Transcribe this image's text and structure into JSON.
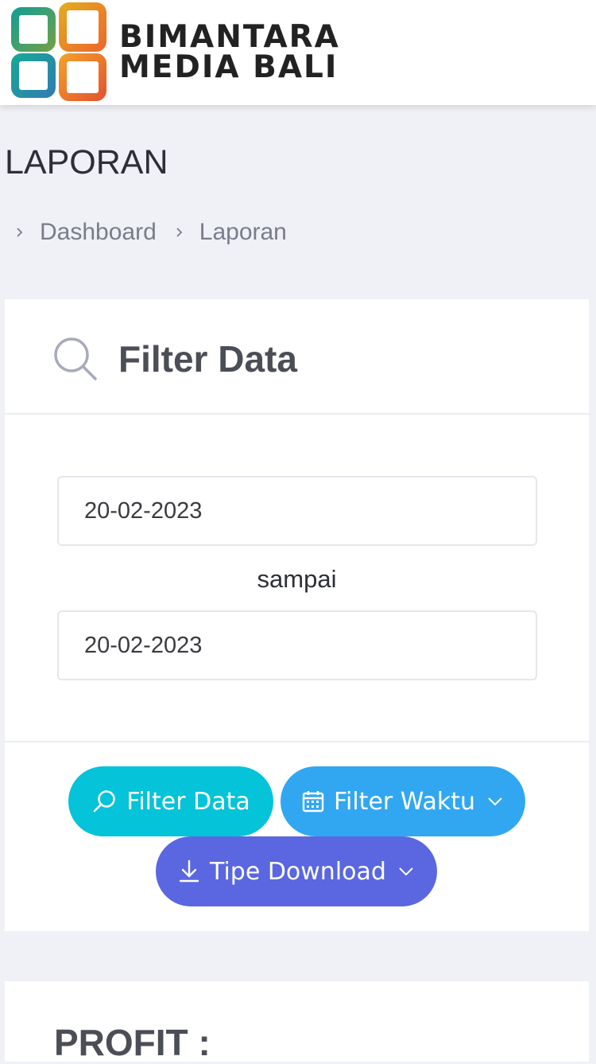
{
  "header": {
    "brand_line1": "BIMANTARA",
    "brand_line2": "MEDIA BALI",
    "logo_icon": "four-squares-logo-icon"
  },
  "page": {
    "title": "LAPORAN",
    "breadcrumb": [
      "Dashboard",
      "Laporan"
    ]
  },
  "filter_card": {
    "title": "Filter Data",
    "title_icon": "search-icon",
    "date_from": "20-02-2023",
    "separator": "sampai",
    "date_to": "20-02-2023",
    "buttons": {
      "filter_data": "Filter Data",
      "filter_waktu": "Filter Waktu",
      "tipe_download": "Tipe Download"
    }
  },
  "profit_card": {
    "label": "PROFIT :"
  },
  "colors": {
    "background": "#f0f1f7",
    "filter_data_button": "#05c3d8",
    "filter_waktu_button": "#31a7f2",
    "tipe_download_button": "#5a67e0",
    "logo_teal": "#1a9e8f",
    "logo_orange": "#f08a24"
  }
}
